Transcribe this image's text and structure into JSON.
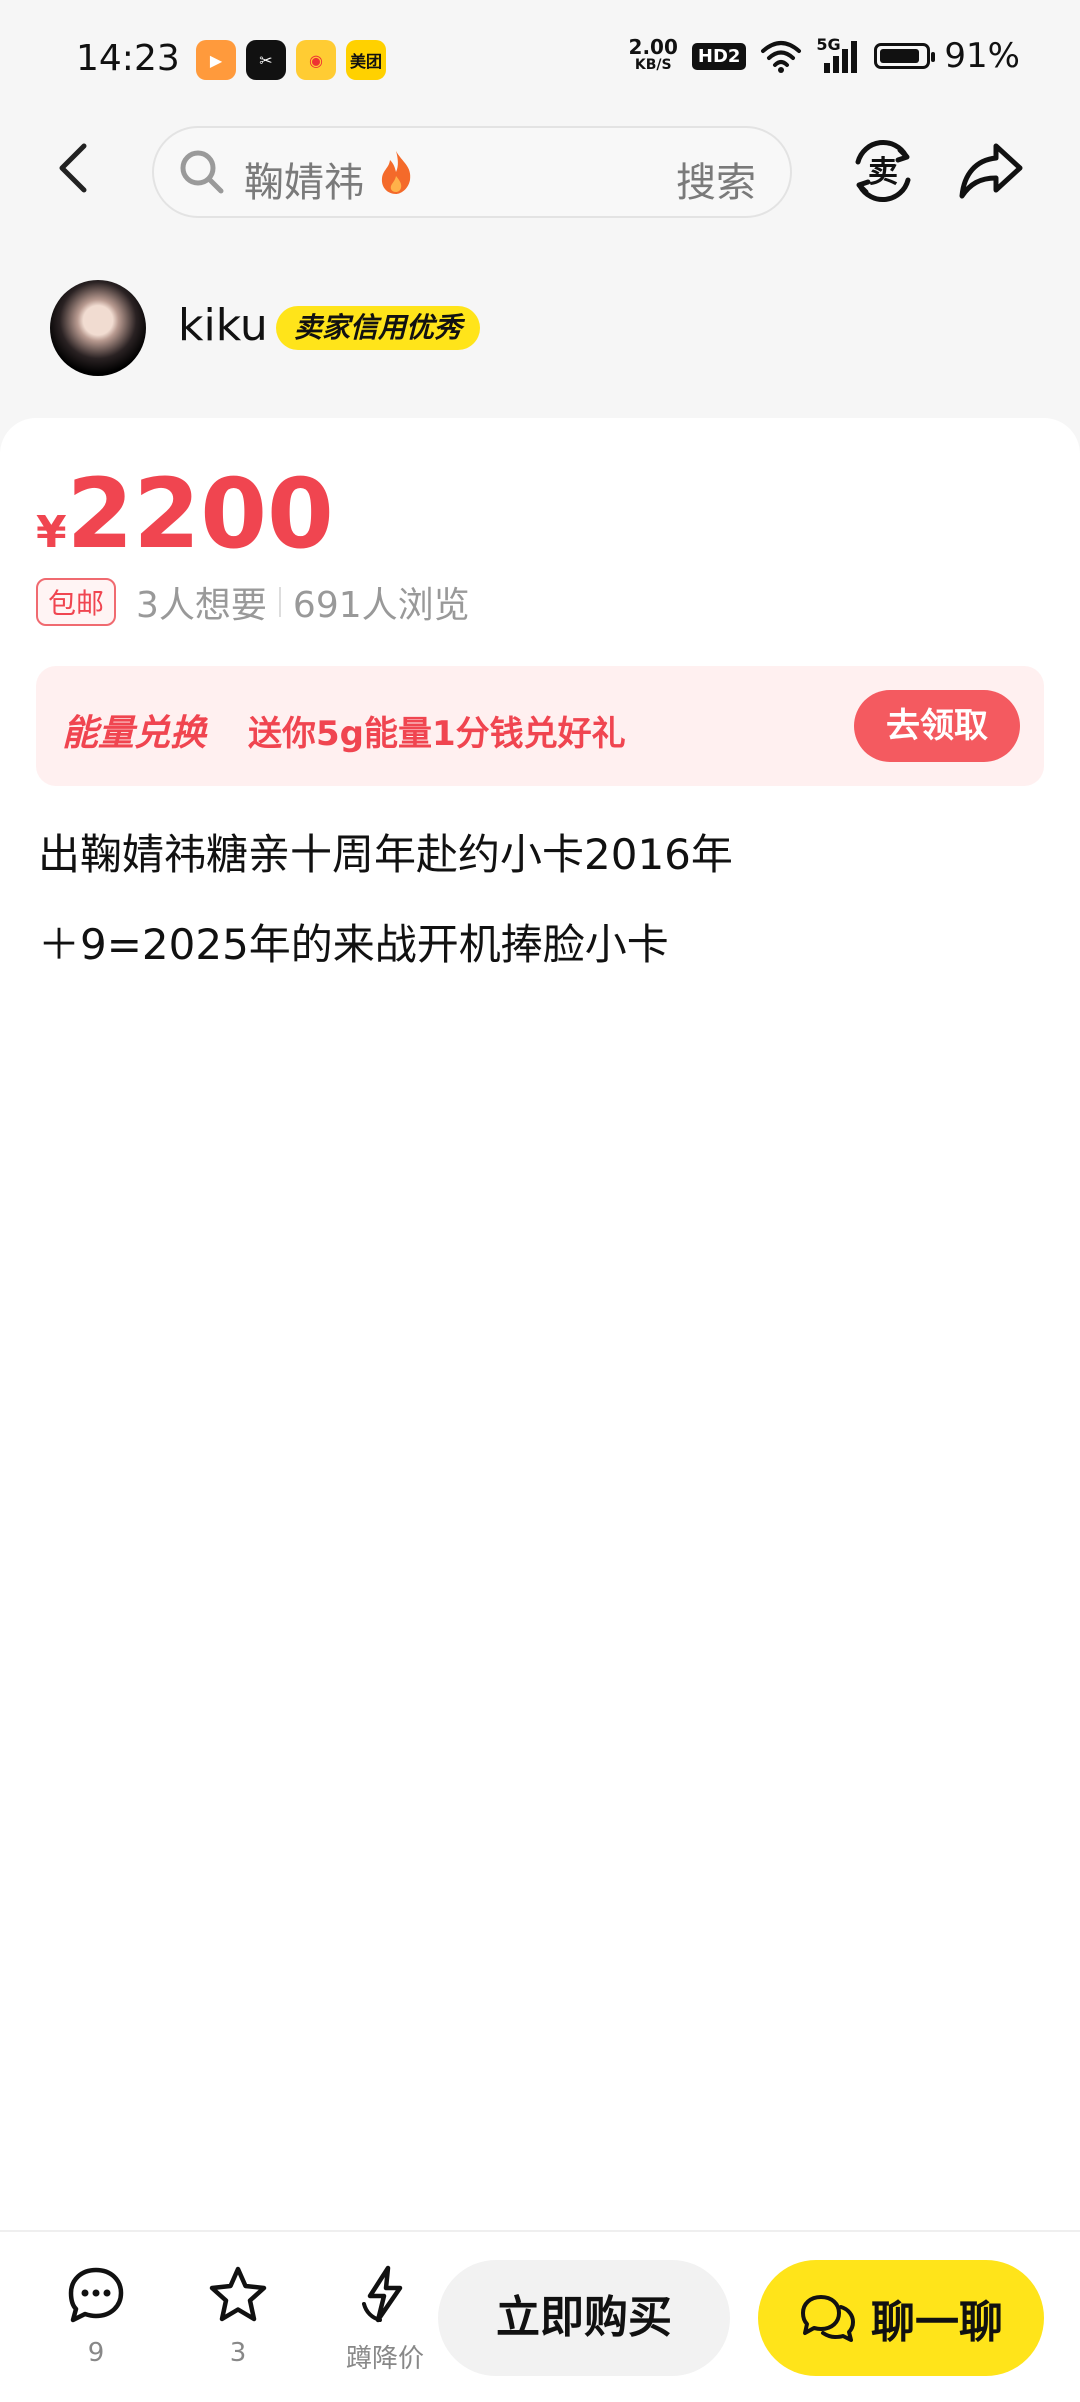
{
  "status_bar": {
    "time": "14:23",
    "apps": [
      {
        "icon": "video-app-icon",
        "color": "#ff9a3c"
      },
      {
        "icon": "capcut-app-icon",
        "color": "#111111"
      },
      {
        "icon": "weibo-app-icon",
        "color": "#ffcc33"
      },
      {
        "icon": "meituan-app-icon",
        "color": "#ffd100",
        "label": "美团"
      }
    ],
    "net_speed_value": "2.00",
    "net_speed_unit": "KB/S",
    "hd_label": "HD2",
    "signal_label": "5G",
    "battery": "91%"
  },
  "header": {
    "search_text": "鞠婧祎",
    "search_button": "搜索"
  },
  "seller": {
    "name": "kiku",
    "badge": "卖家信用优秀"
  },
  "item": {
    "currency": "¥",
    "price": "2200",
    "shipping_tag": "包邮",
    "wants": "3人想要",
    "views": "691人浏览",
    "energy_title": "能量兑换",
    "energy_desc": "送你5g能量1分钱兑好礼",
    "claim_button": "去领取",
    "description_line1": "出鞠婧祎糖亲十周年赴约小卡2016年",
    "description_line2": "＋9=2025年的来战开机捧脸小卡"
  },
  "bottom_bar": {
    "comments_count": "9",
    "favorites_count": "3",
    "price_drop_label": "蹲降价",
    "buy_button": "立即购买",
    "chat_button": "聊一聊"
  },
  "colors": {
    "accent_red": "#f04550",
    "brand_yellow": "#ffe41a"
  }
}
